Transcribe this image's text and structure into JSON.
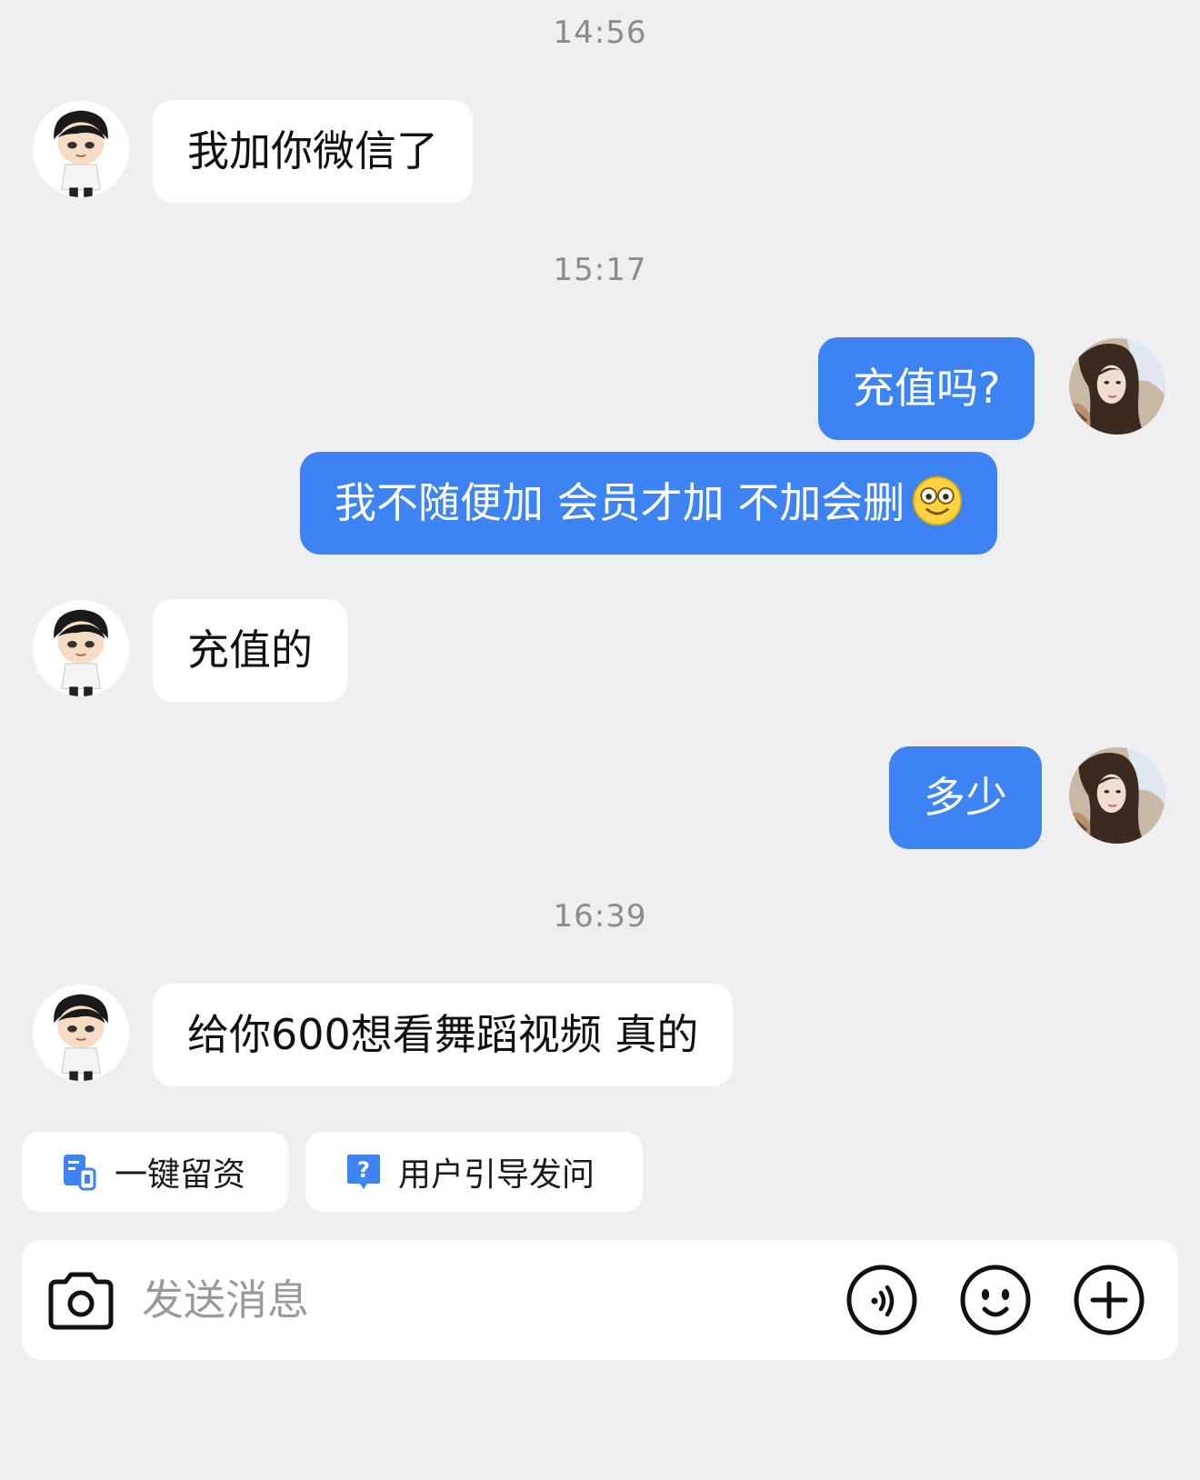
{
  "timestamps": [
    "14:56",
    "15:17",
    "16:39"
  ],
  "messages": [
    {
      "side": "in",
      "text": "我加你微信了"
    },
    {
      "side": "out",
      "text": "充值吗?"
    },
    {
      "side": "out",
      "text": "我不随便加 会员才加 不加会删",
      "emoji": "grinning-face-emoji"
    },
    {
      "side": "in",
      "text": "充值的"
    },
    {
      "side": "out",
      "text": "多少"
    },
    {
      "side": "in",
      "text": "给你600想看舞蹈视频 真的"
    }
  ],
  "quick_actions": [
    {
      "label": "一键留资",
      "icon": "form-icon"
    },
    {
      "label": "用户引导发问",
      "icon": "question-icon"
    }
  ],
  "input": {
    "placeholder": "发送消息"
  },
  "toolbar_icons": [
    "camera-icon",
    "voice-icon",
    "emoji-icon",
    "plus-icon"
  ],
  "colors": {
    "outgoing_bubble": "#3e83f2",
    "incoming_bubble": "#ffffff",
    "background": "#efeff1",
    "accent": "#3e83f2"
  }
}
